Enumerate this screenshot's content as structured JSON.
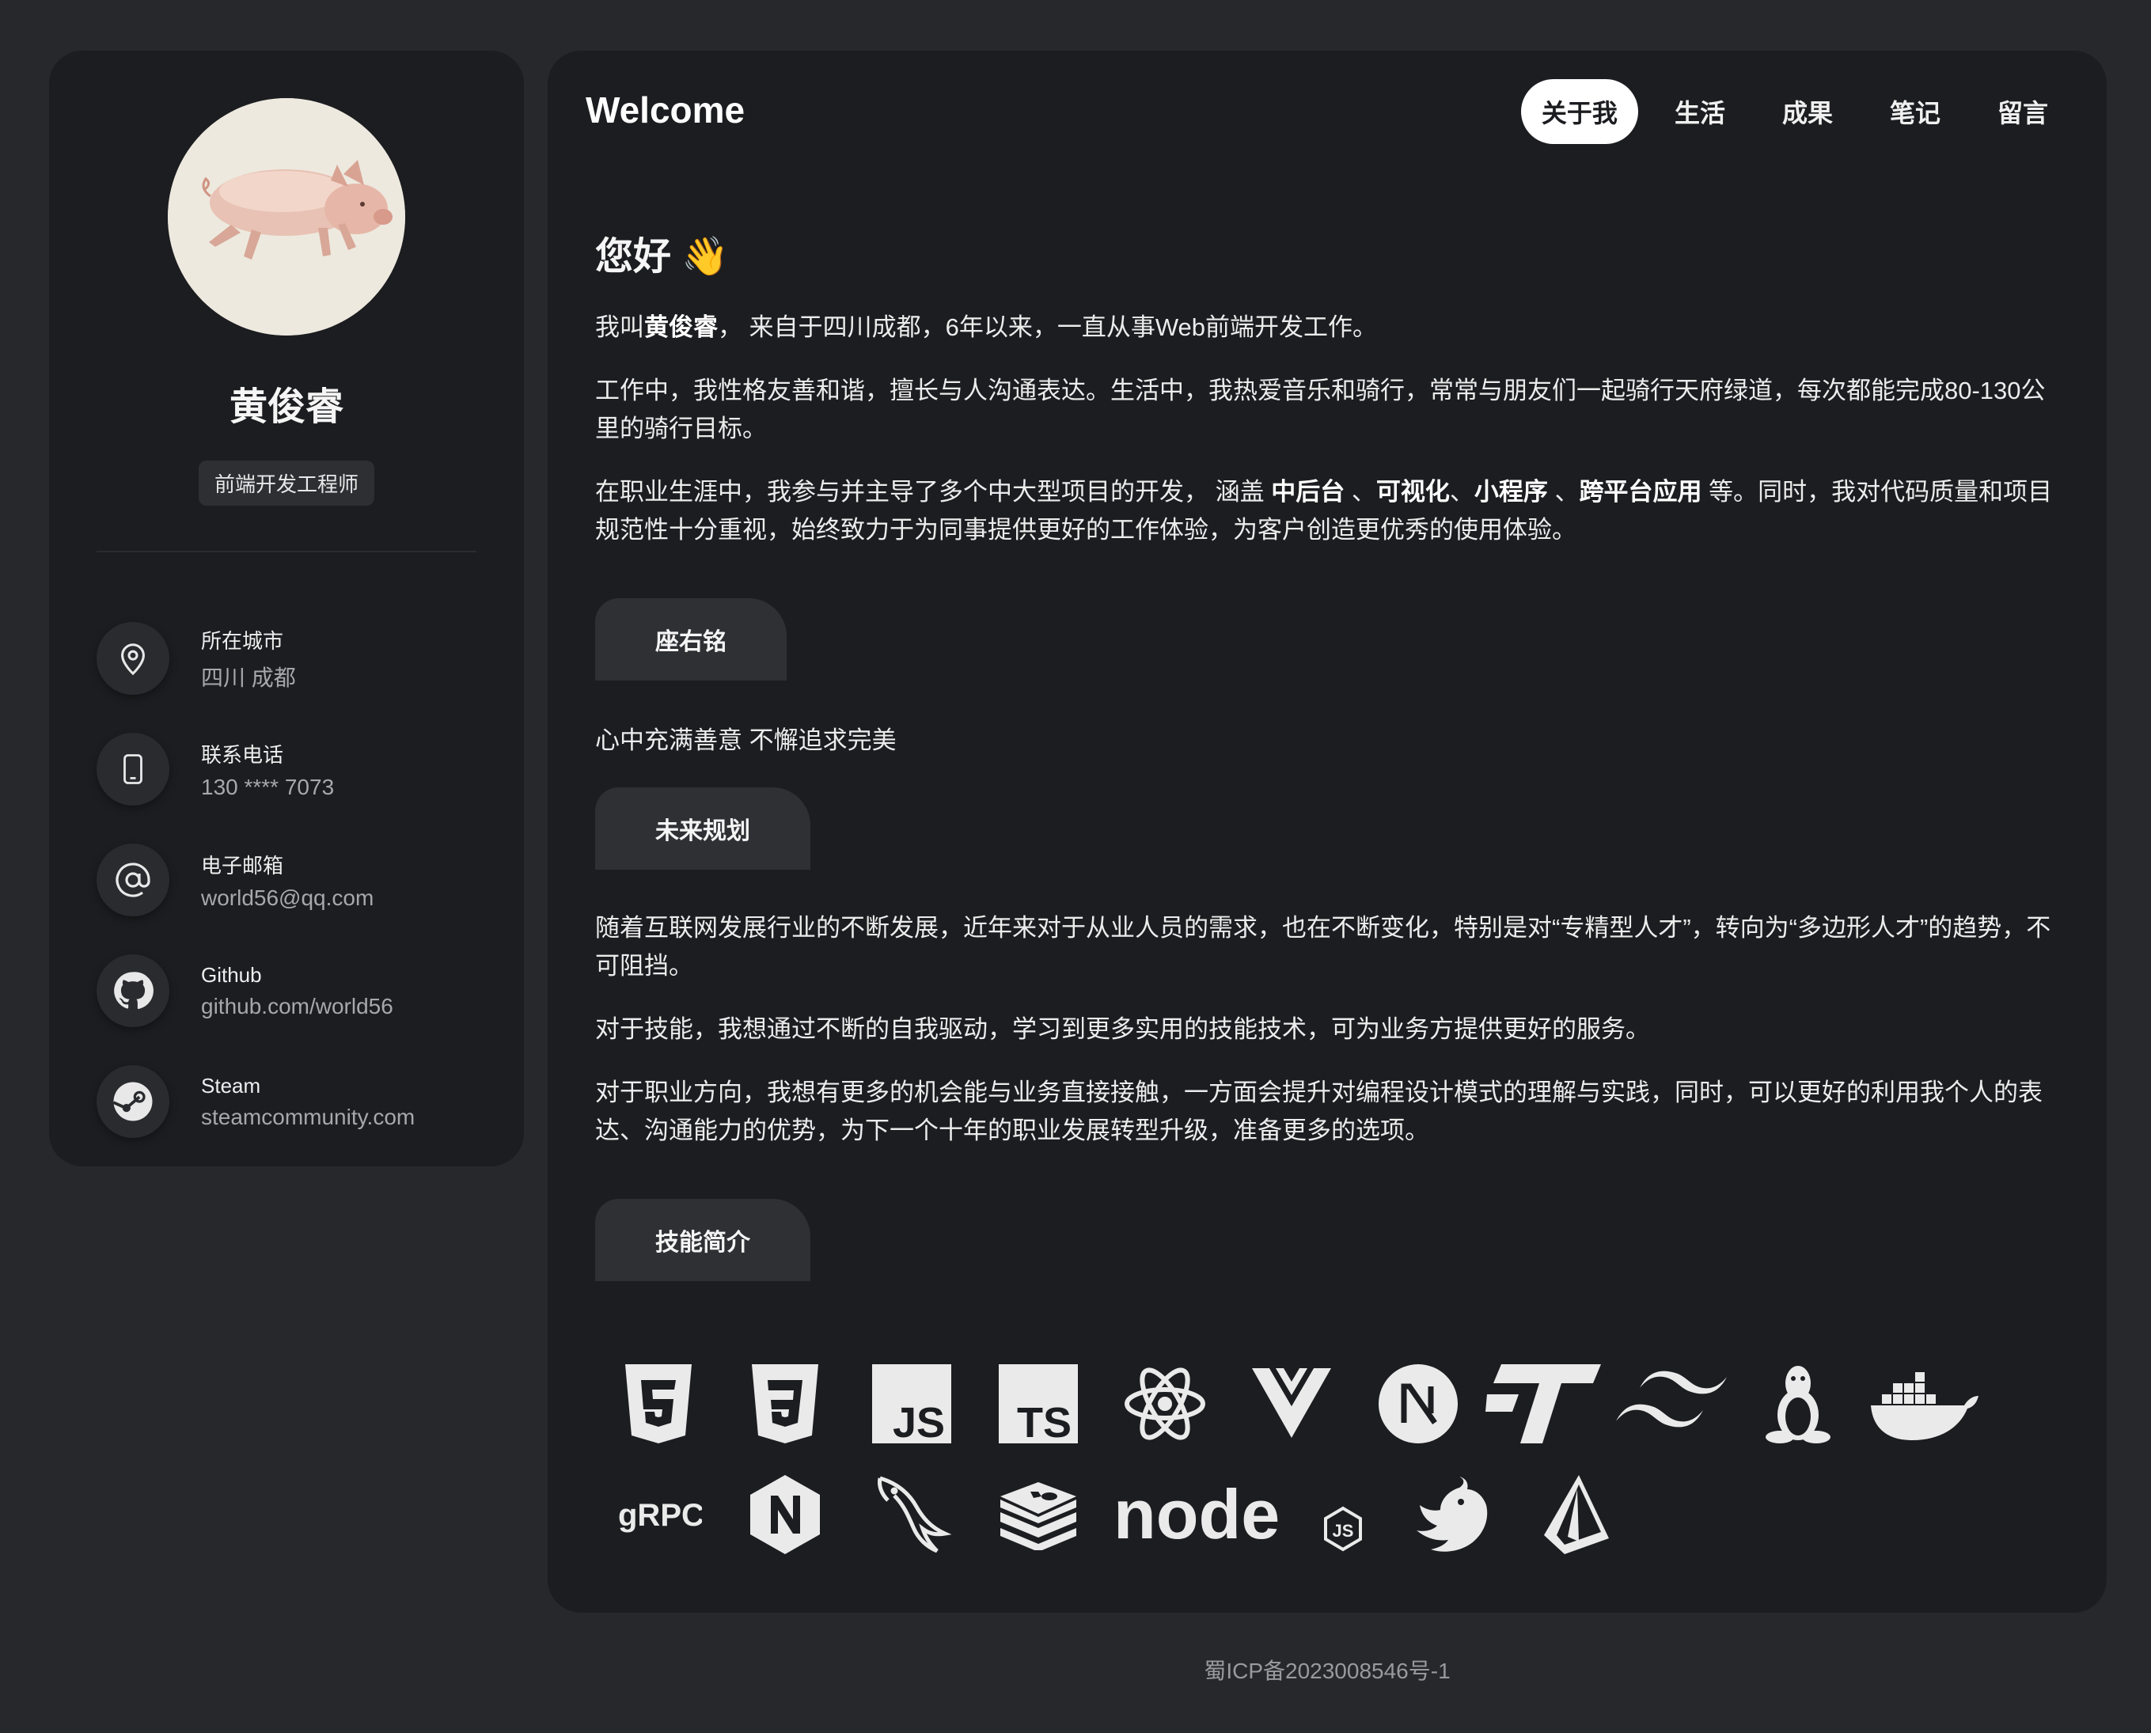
{
  "sidebar": {
    "name": "黄俊睿",
    "title": "前端开发工程师",
    "contacts": [
      {
        "icon": "location-pin-icon",
        "label": "所在城市",
        "value": "四川 成都"
      },
      {
        "icon": "phone-icon",
        "label": "联系电话",
        "value": "130 **** 7073"
      },
      {
        "icon": "at-sign-icon",
        "label": "电子邮箱",
        "value": "world56@qq.com"
      },
      {
        "icon": "github-icon",
        "label": "Github",
        "value": "github.com/world56"
      },
      {
        "icon": "steam-icon",
        "label": "Steam",
        "value": "steamcommunity.com"
      }
    ]
  },
  "header": {
    "title": "Welcome",
    "tabs": [
      {
        "label": "关于我",
        "active": true
      },
      {
        "label": "生活",
        "active": false
      },
      {
        "label": "成果",
        "active": false
      },
      {
        "label": "笔记",
        "active": false
      },
      {
        "label": "留言",
        "active": false
      }
    ]
  },
  "about": {
    "greeting": "您好 👋",
    "intro": {
      "p1_pre": "我叫",
      "p1_name": "黄俊睿",
      "p1_post": "，  来自于四川成都，6年以来，一直从事Web前端开发工作。",
      "p2": "工作中，我性格友善和谐，擅长与人沟通表达。生活中，我热爱音乐和骑行，常常与朋友们一起骑行天府绿道，每次都能完成80-130公里的骑行目标。",
      "p3_pre": "在职业生涯中，我参与并主导了多个中大型项目的开发，  涵盖 ",
      "p3_b1": "中后台",
      "p3_s1": " 、",
      "p3_b2": "可视化",
      "p3_s2": "、",
      "p3_b3": "小程序",
      "p3_s3": " 、",
      "p3_b4": "跨平台应用",
      "p3_post": " 等。同时，我对代码质量和项目规范性十分重视，始终致力于为同事提供更好的工作体验，为客户创造更优秀的使用体验。"
    },
    "motto_tab": "座右铭",
    "motto": "心中充满善意 不懈追求完美",
    "plan_tab": "未来规划",
    "plan_p1": "随着互联网发展行业的不断发展，近年来对于从业人员的需求，也在不断变化，特别是对“专精型人才”，转向为“多边形人才”的趋势，不可阻挡。",
    "plan_p2": "对于技能，我想通过不断的自我驱动，学习到更多实用的技能技术，可为业务方提供更好的服务。",
    "plan_p3": "对于职业方向，我想有更多的机会能与业务直接接触，一方面会提升对编程设计模式的理解与实践，同时，可以更好的利用我个人的表达、沟通能力的优势，为下一个十年的职业发展转型升级，准备更多的选项。",
    "skills_tab": "技能简介"
  },
  "skills": {
    "row1": [
      "html5-icon",
      "css3-icon",
      "javascript-icon",
      "typescript-icon",
      "react-icon",
      "vue-icon",
      "nextjs-icon",
      "turborepo-icon",
      "tailwind-icon",
      "linux-icon",
      "docker-icon"
    ],
    "row2": [
      "grpc-icon",
      "nginx-icon",
      "mysql-icon",
      "redis-icon",
      "nodejs-icon",
      "nestjs-icon",
      "prisma-icon"
    ],
    "labels": {
      "js": "JS",
      "ts": "TS",
      "grpc": "gRPC",
      "node": "node",
      "node_js": "JS"
    }
  },
  "footer": {
    "icp": "蜀ICP备2023008546号-1"
  }
}
